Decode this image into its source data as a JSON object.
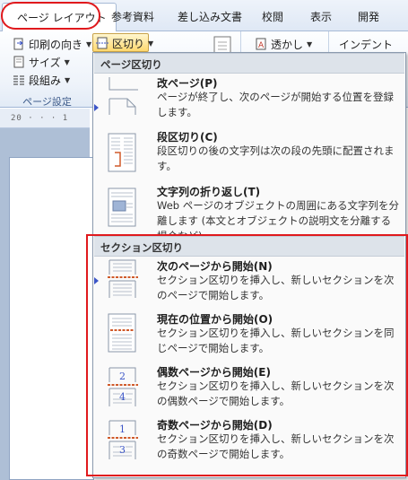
{
  "ribbon": {
    "tabs": [
      {
        "label": "ページ レイアウト"
      },
      {
        "label": "参考資料"
      },
      {
        "label": "差し込み文書"
      },
      {
        "label": "校閲"
      },
      {
        "label": "表示"
      },
      {
        "label": "開発"
      }
    ],
    "page_setup": {
      "print_direction": "印刷の向き",
      "size": "サイズ",
      "columns": "段組み",
      "group_label": "ページ設定"
    },
    "breaks_button": "区切り",
    "watermark": "透かし",
    "indent": "インデント"
  },
  "ruler": {
    "text": "20 · · · 1"
  },
  "breaks_menu": {
    "page_section_header": "ページ区切り",
    "section_break_header": "セクション区切り",
    "page_items": [
      {
        "title": "改ページ(P)",
        "desc": "ページが終了し、次のページが開始する位置を登録します。",
        "icon": "page-break-icon"
      },
      {
        "title": "段区切り(C)",
        "desc": "段区切りの後の文字列は次の段の先頭に配置されます。",
        "icon": "column-break-icon"
      },
      {
        "title": "文字列の折り返し(T)",
        "desc": "Web ページのオブジェクトの周囲にある文字列を分離します (本文とオブジェクトの説明文を分離する場合など)。",
        "icon": "text-wrapping-break-icon"
      }
    ],
    "section_items": [
      {
        "title": "次のページから開始(N)",
        "desc": "セクション区切りを挿入し、新しいセクションを次のページで開始します。",
        "icon": "next-page-section-icon"
      },
      {
        "title": "現在の位置から開始(O)",
        "desc": "セクション区切りを挿入し、新しいセクションを同じページで開始します。",
        "icon": "continuous-section-icon"
      },
      {
        "title": "偶数ページから開始(E)",
        "desc": "セクション区切りを挿入し、新しいセクションを次の偶数ページで開始します。",
        "icon": "even-page-section-icon",
        "number_top": "2",
        "number_bottom": "4"
      },
      {
        "title": "奇数ページから開始(D)",
        "desc": "セクション区切りを挿入し、新しいセクションを次の奇数ページで開始します。",
        "icon": "odd-page-section-icon",
        "number_top": "1",
        "number_bottom": "3"
      }
    ]
  },
  "colors": {
    "highlight_red": "#e0191d",
    "accent_blue": "#3b55c7",
    "break_line_red": "#d05a2a"
  }
}
